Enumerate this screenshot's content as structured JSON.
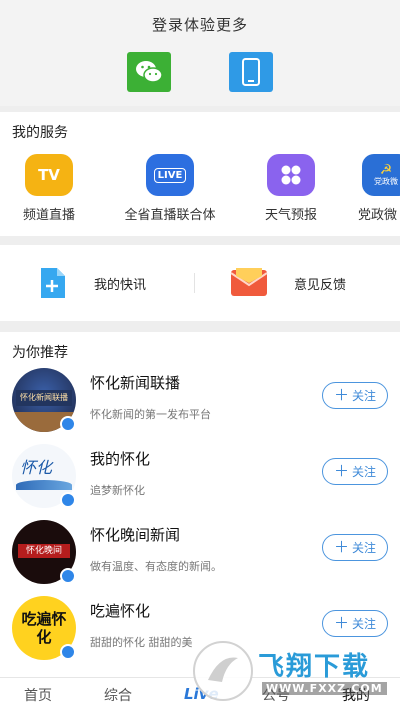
{
  "login": {
    "title": "登录体验更多",
    "wechat_icon": "wechat-icon",
    "phone_icon": "phone-icon"
  },
  "services": {
    "title": "我的服务",
    "items": [
      {
        "label": "频道直播",
        "icon": "tv-icon",
        "icon_text": "TV",
        "color": "#f5b313"
      },
      {
        "label": "全省直播联合体",
        "icon": "live-icon",
        "icon_text": "LIVE",
        "color": "#2d6fe0"
      },
      {
        "label": "天气预报",
        "icon": "grid-icon",
        "icon_text": "",
        "color": "#8a63ee"
      },
      {
        "label": "党政微",
        "icon": "party-icon",
        "icon_text": "党政微",
        "color": "#2a6fd6"
      }
    ]
  },
  "quick": {
    "items": [
      {
        "label": "我的快讯",
        "icon": "doc-add-icon",
        "color": "#36a8f0"
      },
      {
        "label": "意见反馈",
        "icon": "envelope-icon",
        "color": "#f05a3c"
      }
    ]
  },
  "recommend": {
    "title": "为你推荐",
    "follow_label": "关注",
    "items": [
      {
        "name": "怀化新闻联播",
        "desc": "怀化新闻的第一发布平台",
        "avatar_text": "怀化新闻联播"
      },
      {
        "name": "我的怀化",
        "desc": "追梦新怀化",
        "avatar_text": "怀化"
      },
      {
        "name": "怀化晚间新闻",
        "desc": "做有温度、有态度的新闻。",
        "avatar_text": "怀化晚间"
      },
      {
        "name": "吃遍怀化",
        "desc": "甜甜的怀化 甜甜的美",
        "avatar_text": "吃遍怀化"
      }
    ]
  },
  "tabs": [
    {
      "label": "首页"
    },
    {
      "label": "综合"
    },
    {
      "label": "Live"
    },
    {
      "label": "公号"
    },
    {
      "label": "我的"
    }
  ],
  "watermark": {
    "text": "飞翔下载",
    "sub": "WWW.FXXZ.COM"
  },
  "colors": {
    "accent": "#3f8ad8",
    "wechat": "#3cb035",
    "phone": "#2f9ae6"
  }
}
